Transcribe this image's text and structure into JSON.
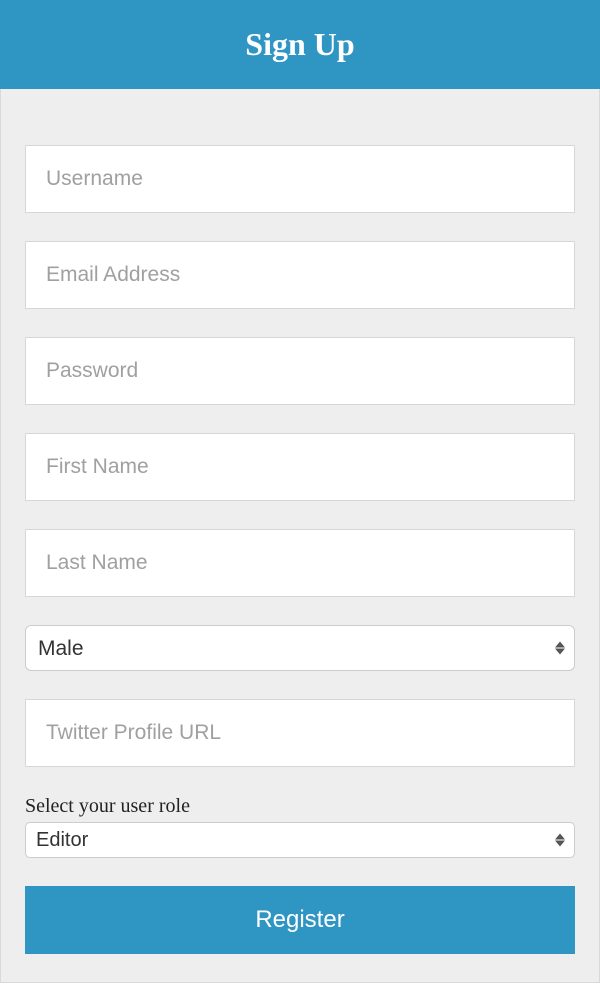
{
  "header": {
    "title": "Sign Up"
  },
  "form": {
    "username": {
      "placeholder": "Username",
      "value": ""
    },
    "email": {
      "placeholder": "Email Address",
      "value": ""
    },
    "password": {
      "placeholder": "Password",
      "value": ""
    },
    "firstName": {
      "placeholder": "First Name",
      "value": ""
    },
    "lastName": {
      "placeholder": "Last Name",
      "value": ""
    },
    "gender": {
      "selected": "Male"
    },
    "twitter": {
      "placeholder": "Twitter Profile URL",
      "value": ""
    },
    "roleLabel": "Select your user role",
    "role": {
      "selected": "Editor"
    },
    "submitLabel": "Register"
  }
}
